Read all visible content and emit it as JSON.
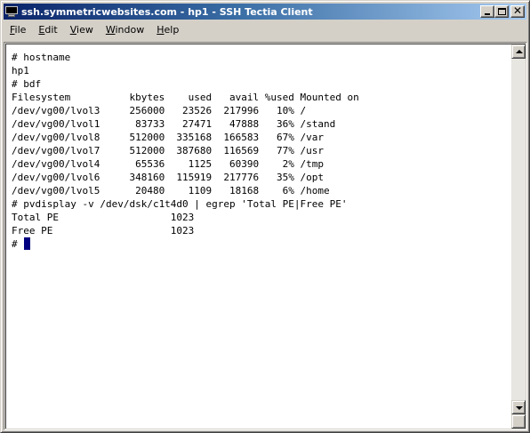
{
  "window": {
    "title": "ssh.symmetricwebsites.com - hp1 - SSH Tectia Client"
  },
  "menu": {
    "items": [
      {
        "accel": "F",
        "rest": "ile"
      },
      {
        "accel": "E",
        "rest": "dit"
      },
      {
        "accel": "V",
        "rest": "iew"
      },
      {
        "accel": "W",
        "rest": "indow"
      },
      {
        "accel": "H",
        "rest": "elp"
      }
    ]
  },
  "terminal": {
    "lines": [
      "# hostname",
      "hp1",
      "# bdf",
      "Filesystem          kbytes    used   avail %used Mounted on",
      "/dev/vg00/lvol3     256000   23526  217996   10% /",
      "/dev/vg00/lvol1      83733   27471   47888   36% /stand",
      "/dev/vg00/lvol8     512000  335168  166583   67% /var",
      "/dev/vg00/lvol7     512000  387680  116569   77% /usr",
      "/dev/vg00/lvol4      65536    1125   60390    2% /tmp",
      "/dev/vg00/lvol6     348160  115919  217776   35% /opt",
      "/dev/vg00/lvol5      20480    1109   18168    6% /home",
      "# pvdisplay -v /dev/dsk/c1t4d0 | egrep 'Total PE|Free PE'",
      "Total PE                   1023",
      "Free PE                    1023"
    ],
    "prompt": "#"
  },
  "icons": {
    "app": "terminal-icon",
    "minimize": "minimize-icon",
    "maximize": "maximize-icon",
    "close": "close-icon",
    "scroll_up": "arrow-up-icon",
    "scroll_down": "arrow-down-icon"
  },
  "colors": {
    "title_start": "#0a246a",
    "title_end": "#a6caf0",
    "cursor": "#000080"
  }
}
